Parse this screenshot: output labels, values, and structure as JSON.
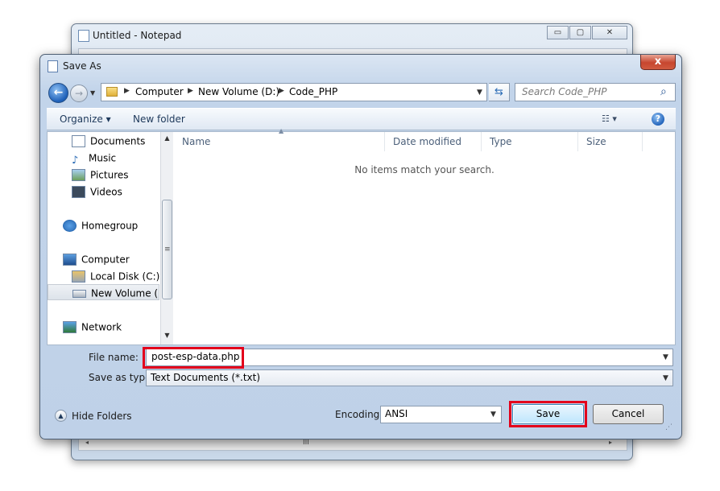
{
  "notepad": {
    "title": "Untitled - Notepad",
    "minimize": "▭",
    "maximize": "▢",
    "close": "✕",
    "status_grip": "III"
  },
  "dialog": {
    "title": "Save As",
    "close": "x",
    "address": {
      "breadcrumbs": [
        "Computer",
        "New Volume (D:)",
        "Code_PHP"
      ]
    },
    "search": {
      "placeholder": "Search Code_PHP"
    },
    "toolbar": {
      "organize": "Organize ▾",
      "new_folder": "New folder",
      "views": "☷ ▾",
      "help": "?"
    },
    "nav_items": [
      {
        "label": "Documents",
        "icon": "documents-icon"
      },
      {
        "label": "Music",
        "icon": "music-icon"
      },
      {
        "label": "Pictures",
        "icon": "pictures-icon"
      },
      {
        "label": "Videos",
        "icon": "videos-icon"
      },
      {
        "label": "Homegroup",
        "icon": "homegroup-icon"
      },
      {
        "label": "Computer",
        "icon": "computer-icon"
      },
      {
        "label": "Local Disk (C:)",
        "icon": "drive-icon"
      },
      {
        "label": "New Volume (D:)",
        "icon": "drive-icon",
        "selected": true
      },
      {
        "label": "Network",
        "icon": "network-icon"
      }
    ],
    "columns": [
      "Name",
      "Date modified",
      "Type",
      "Size"
    ],
    "empty_message": "No items match your search.",
    "file_name_label": "File name:",
    "file_name_value": "post-esp-data.php",
    "save_as_type_label": "Save as type:",
    "save_as_type_value": "Text Documents (*.txt)",
    "hide_folders": "Hide Folders",
    "encoding_label": "Encoding:",
    "encoding_value": "ANSI",
    "save_button": "Save",
    "cancel_button": "Cancel"
  },
  "colors": {
    "highlight_red": "#e3001b",
    "save_button_blue": "#bee6fd",
    "close_red": "#c7462f"
  }
}
